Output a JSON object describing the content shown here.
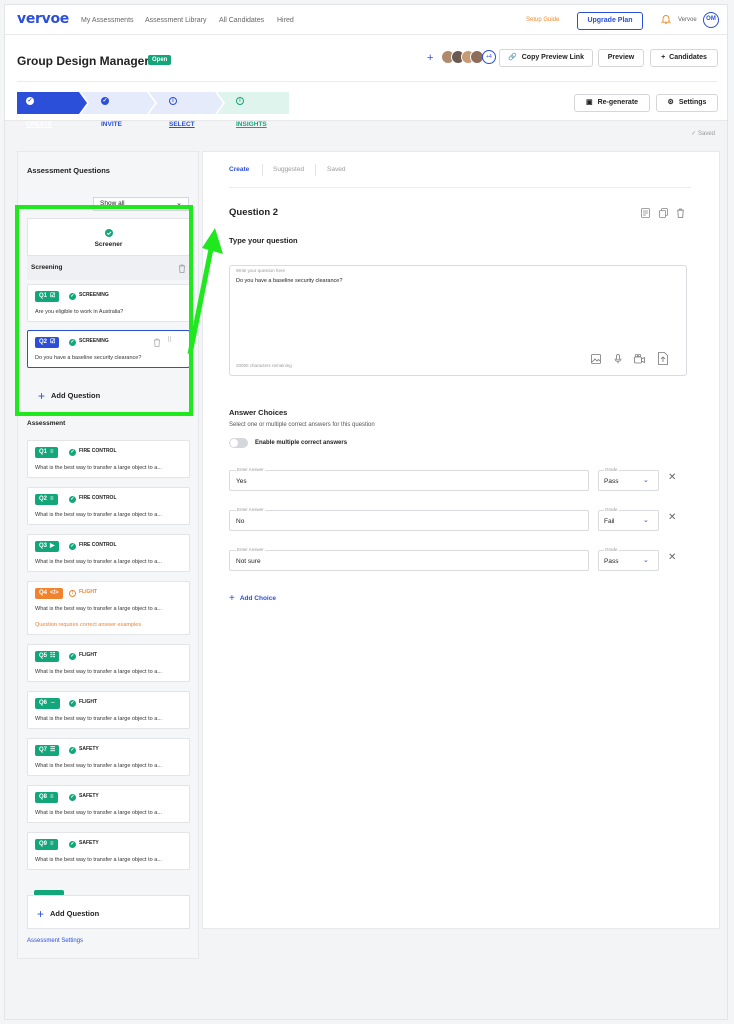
{
  "topnav": {
    "logo": "vervoe",
    "links": [
      "My Assessments",
      "Assessment Library",
      "All Candidates",
      "Hired"
    ],
    "setup_guide": "Setup Guide",
    "upgrade": "Upgrade Plan",
    "user_name": "Vervoe",
    "user_initials": "OM"
  },
  "header": {
    "title": "Group Design Manager",
    "status": "Open",
    "avatars_more": "+4",
    "copy_link": "Copy Preview Link",
    "preview": "Preview",
    "candidates": "Candidates",
    "steps": [
      "CREATE",
      "INVITE",
      "SELECT",
      "INSIGHTS"
    ],
    "regenerate": "Re-generate",
    "settings": "Settings"
  },
  "saved": "Saved",
  "left": {
    "title": "Assessment Questions",
    "filter": "Show all",
    "screener": "Screener",
    "screening_label": "Screening",
    "screening_questions": [
      {
        "num": "Q1",
        "cat": "SCREENING",
        "text": "Are you eligible to work in Australia?"
      },
      {
        "num": "Q2",
        "cat": "SCREENING",
        "text": "Do you have a baseline security clearance?"
      }
    ],
    "add_question": "Add Question",
    "assessment_label": "Assessment",
    "assessment_questions": [
      {
        "num": "Q1",
        "cat": "FIRE CONTROL",
        "text": "What is the best way to transfer a large object to a...",
        "icon": "≡"
      },
      {
        "num": "Q2",
        "cat": "FIRE CONTROL",
        "text": "What is the best way to transfer a large object to a...",
        "icon": "≡"
      },
      {
        "num": "Q3",
        "cat": "FIRE CONTROL",
        "text": "What is the best way to transfer a large object to a...",
        "icon": "▶"
      },
      {
        "num": "Q4",
        "cat": "FLIGHT",
        "text": "What is the best way to transfer a large object to a...",
        "icon": "</>",
        "warning": "Question requires correct answer examples"
      },
      {
        "num": "Q5",
        "cat": "FLIGHT",
        "text": "What is the best way to transfer a large object to a...",
        "icon": "☷"
      },
      {
        "num": "Q6",
        "cat": "FLIGHT",
        "text": "What is the best way to transfer a large object to a...",
        "icon": "⇔"
      },
      {
        "num": "Q7",
        "cat": "SAFETY",
        "text": "What is the best way to transfer a large object to a...",
        "icon": "☰"
      },
      {
        "num": "Q8",
        "cat": "SAFETY",
        "text": "What is the best way to transfer a large object to a...",
        "icon": "≡"
      },
      {
        "num": "Q9",
        "cat": "SAFETY",
        "text": "What is the best way to transfer a large object to a...",
        "icon": "≡"
      }
    ],
    "assessment_settings": "Assessment Settings"
  },
  "main": {
    "tabs": [
      "Create",
      "Suggested",
      "Saved"
    ],
    "question_title": "Question 2",
    "type_question": "Type your question",
    "question_placeholder": "Write your question here",
    "question_value": "Do you have a baseline security clearance?",
    "chars_remaining": "20000 characters remaining",
    "answer_choices_title": "Answer Choices",
    "answer_choices_sub": "Select one or multiple correct answers for this question",
    "multiple_toggle": "Enable multiple correct answers",
    "answer_label": "Enter Answer",
    "grade_label": "Grade",
    "answers": [
      {
        "text": "Yes",
        "grade": "Pass"
      },
      {
        "text": "No",
        "grade": "Fail"
      },
      {
        "text": "Not sure",
        "grade": "Pass"
      }
    ],
    "add_choice": "Add Choice"
  },
  "colors": {
    "brand_blue": "#2b4fd8",
    "green": "#12a67a",
    "orange": "#f0832d",
    "highlight": "#1fe81f"
  }
}
